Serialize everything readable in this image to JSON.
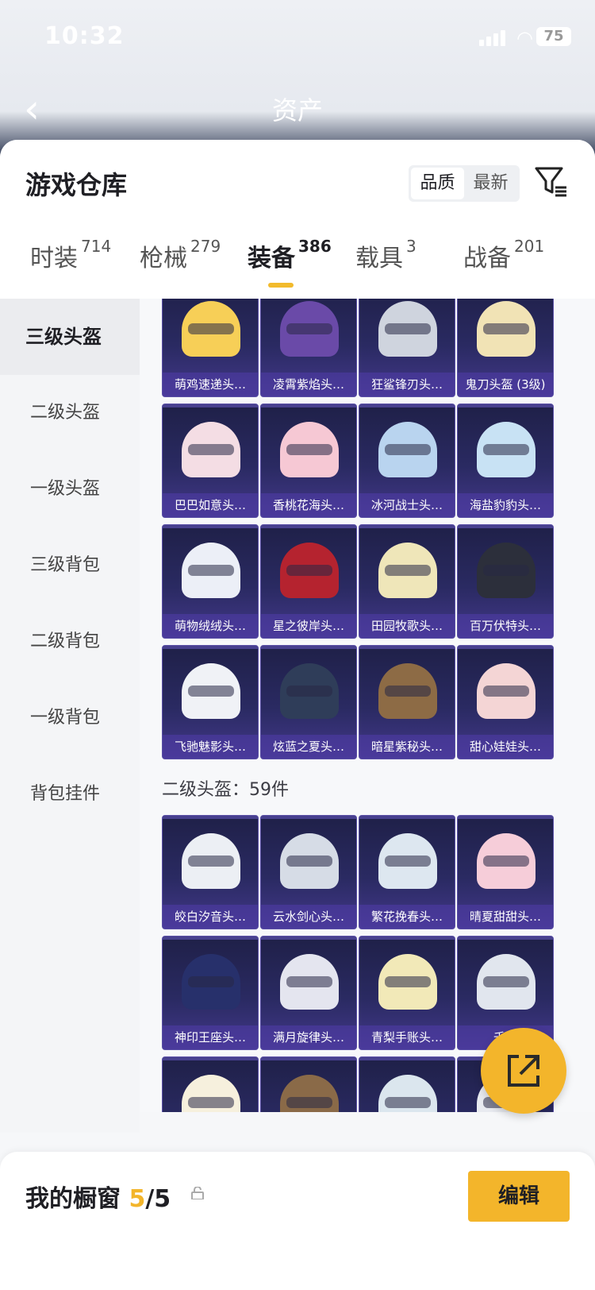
{
  "status": {
    "time": "10:32",
    "battery": "75"
  },
  "nav": {
    "title": "资产"
  },
  "sheet": {
    "title": "游戏仓库",
    "sort": [
      "品质",
      "最新"
    ],
    "categories": [
      {
        "label": "时装",
        "count": "714"
      },
      {
        "label": "枪械",
        "count": "279"
      },
      {
        "label": "装备",
        "count": "386"
      },
      {
        "label": "载具",
        "count": "3"
      },
      {
        "label": "战备",
        "count": "201"
      }
    ]
  },
  "sidebar": [
    "三级头盔",
    "二级头盔",
    "一级头盔",
    "三级背包",
    "二级背包",
    "一级背包",
    "背包挂件"
  ],
  "grid": {
    "level3": [
      "萌鸡速递头…",
      "凌霄紫焰头…",
      "狂鲨锋刃头…",
      "鬼刀头盔 (3级)",
      "巴巴如意头…",
      "香桃花海头…",
      "冰河战士头…",
      "海盐豹豹头…",
      "萌物绒绒头…",
      "星之彼岸头…",
      "田园牧歌头…",
      "百万伏特头…",
      "飞驰魅影头…",
      "炫蓝之夏头…",
      "暗星紫秘头…",
      "甜心娃娃头…"
    ],
    "level2_label": "二级头盔：59件",
    "level2": [
      "皎白汐音头…",
      "云水剑心头…",
      "繁花挽春头…",
      "晴夏甜甜头…",
      "神印王座头…",
      "满月旋律头…",
      "青梨手账头…",
      "千…"
    ]
  },
  "bottom": {
    "label": "我的橱窗",
    "count_used": "5",
    "count_total": "/5",
    "edit": "编辑"
  },
  "colors": {
    "accent": "#f3b52b",
    "card": "#2a2a62"
  }
}
